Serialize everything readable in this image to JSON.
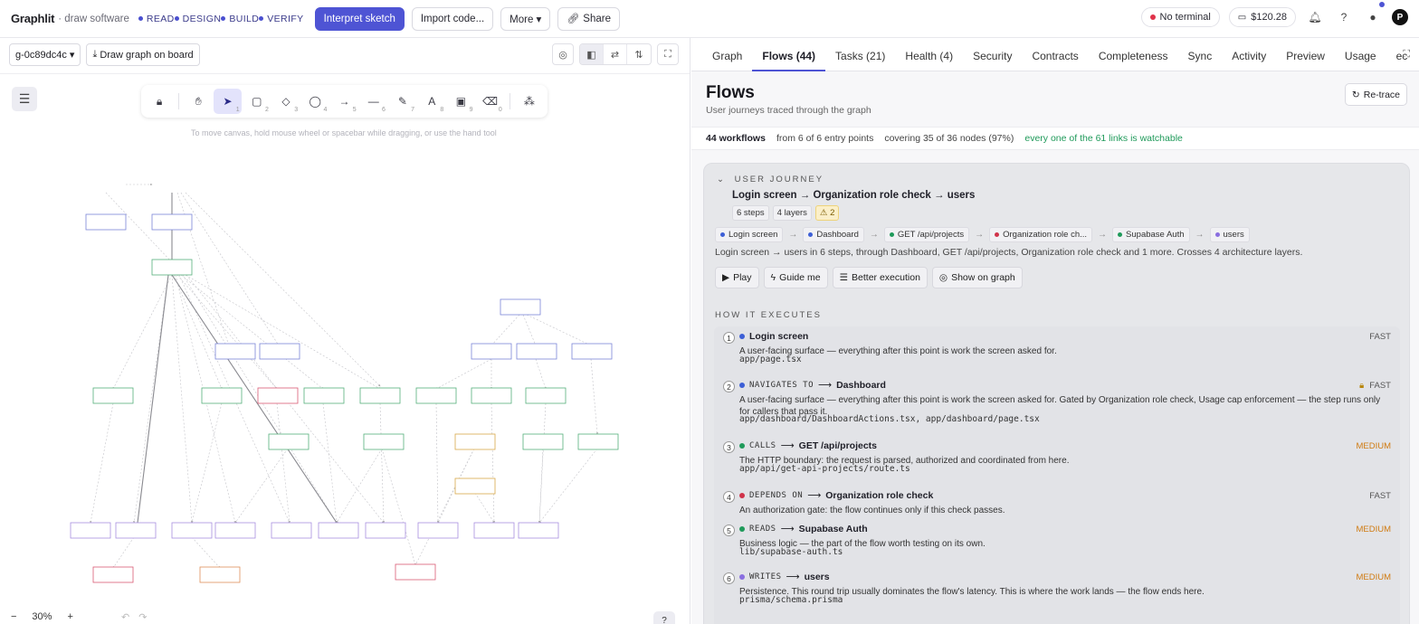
{
  "app": {
    "brand": "Graphlit",
    "brand_sub": "· draw software"
  },
  "phases": [
    "READ",
    "DESIGN",
    "BUILD",
    "VERIFY"
  ],
  "toolbar": {
    "interpret": "Interpret sketch",
    "import": "Import code...",
    "more": "More ▾",
    "share": "Share"
  },
  "status": {
    "terminal": "No terminal",
    "credits": "$120.28",
    "avatar": "P"
  },
  "canvas": {
    "graph_select": "g-0c89dc4c ▾",
    "draw_button": "Draw graph on board",
    "hint": "To move canvas, hold mouse wheel or spacebar while dragging, or use the hand tool",
    "zoom": "30%",
    "tools": [
      {
        "icon": "lock-icon",
        "glyph": "🔒︎",
        "key": ""
      },
      {
        "icon": "hand-icon",
        "glyph": "✋︎",
        "key": ""
      },
      {
        "icon": "pointer-icon",
        "glyph": "➤",
        "key": "1"
      },
      {
        "icon": "rectangle-icon",
        "glyph": "▢",
        "key": "2"
      },
      {
        "icon": "diamond-icon",
        "glyph": "◇",
        "key": "3"
      },
      {
        "icon": "ellipse-icon",
        "glyph": "◯",
        "key": "4"
      },
      {
        "icon": "arrow-icon",
        "glyph": "→",
        "key": "5"
      },
      {
        "icon": "line-icon",
        "glyph": "—",
        "key": "6"
      },
      {
        "icon": "pencil-icon",
        "glyph": "✎",
        "key": "7"
      },
      {
        "icon": "text-icon",
        "glyph": "A",
        "key": "8"
      },
      {
        "icon": "image-icon",
        "glyph": "▣",
        "key": "9"
      },
      {
        "icon": "eraser-icon",
        "glyph": "⌫",
        "key": "0"
      },
      {
        "icon": "shapes-icon",
        "glyph": "⁂",
        "key": ""
      }
    ]
  },
  "tabs": [
    "Graph",
    "Flows (44)",
    "Tasks (21)",
    "Health (4)",
    "Security",
    "Contracts",
    "Completeness",
    "Sync",
    "Activity",
    "Preview",
    "Usage",
    "ec"
  ],
  "flows": {
    "title": "Flows",
    "subtitle": "User journeys traced through the graph",
    "retrace": "Re-trace",
    "stats": {
      "count": "44 workflows",
      "entry": "from 6 of 6 entry points",
      "coverage": "covering 35 of 36 nodes (97%)",
      "links": "every one of the 61 links is watchable"
    },
    "journey": {
      "label": "USER JOURNEY",
      "title": "Login screen → Organization role check → users",
      "badges": {
        "steps": "6 steps",
        "layers": "4 layers",
        "warnings": "2"
      },
      "chain": [
        {
          "label": "Login screen",
          "color": "#3d5fd6"
        },
        {
          "label": "Dashboard",
          "color": "#3d5fd6"
        },
        {
          "label": "GET /api/projects",
          "color": "#1f9a5a"
        },
        {
          "label": "Organization role ch...",
          "color": "#d0334a"
        },
        {
          "label": "Supabase Auth",
          "color": "#1f9a5a"
        },
        {
          "label": "users",
          "color": "#8a6ee0"
        }
      ],
      "summary": "Login screen → users in 6 steps, through Dashboard, GET /api/projects, Organization role check and 1 more. Crosses 4 architecture layers.",
      "actions": {
        "play": "Play",
        "guide": "Guide me",
        "better": "Better execution",
        "show": "Show on graph"
      },
      "how_label": "HOW IT EXECUTES",
      "steps": [
        {
          "num": "1",
          "verb": "",
          "target": "Login screen",
          "color": "#3d5fd6",
          "speed": "FAST",
          "desc": "A user-facing surface — everything after this point is work the screen asked for.",
          "file": "app/page.tsx"
        },
        {
          "num": "2",
          "verb": "NAVIGATES TO",
          "target": "Dashboard",
          "color": "#3d5fd6",
          "speed": "FAST",
          "desc": "A user-facing surface — everything after this point is work the screen asked for. Gated by Organization role check, Usage cap enforcement — the step runs only for callers that pass it.",
          "file": "app/dashboard/DashboardActions.tsx, app/dashboard/page.tsx"
        },
        {
          "num": "3",
          "verb": "CALLS",
          "target": "GET /api/projects",
          "color": "#1f9a5a",
          "speed": "MEDIUM",
          "desc": "The HTTP boundary: the request is parsed, authorized and coordinated from here.",
          "file": "app/api/get-api-projects/route.ts"
        },
        {
          "num": "4",
          "verb": "DEPENDS ON",
          "target": "Organization role check",
          "color": "#d0334a",
          "speed": "FAST",
          "desc": "An authorization gate: the flow continues only if this check passes.",
          "file": ""
        },
        {
          "num": "5",
          "verb": "READS",
          "target": "Supabase Auth",
          "color": "#1f9a5a",
          "speed": "MEDIUM",
          "desc": "Business logic — the part of the flow worth testing on its own.",
          "file": "lib/supabase-auth.ts"
        },
        {
          "num": "6",
          "verb": "WRITES",
          "target": "users",
          "color": "#8a6ee0",
          "speed": "MEDIUM",
          "desc": "Persistence. This round trip usually dominates the flow's latency. This is where the work lands — the flow ends here.",
          "file": "prisma/schema.prisma"
        }
      ]
    }
  }
}
